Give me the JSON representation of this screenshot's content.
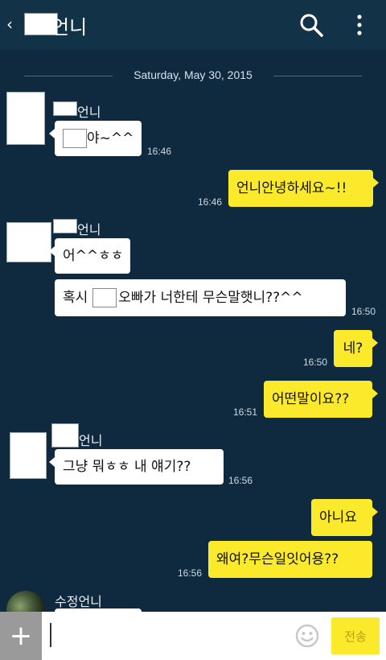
{
  "header": {
    "back_glyph": "‹",
    "title": "언니",
    "search_icon": "search-icon",
    "more_icon": "more-vertical-icon"
  },
  "date_divider": "Saturday, May 30, 2015",
  "messages": [
    {
      "sender": "언니",
      "text_suffix": "야~^^",
      "time": "16:46"
    },
    {
      "text": "언니안녕하세요~!!",
      "time": "16:46"
    },
    {
      "sender": "언니",
      "text": "어^^ㅎㅎ"
    },
    {
      "text_prefix": "혹시",
      "text_suffix": "오빠가 너한테 무슨말햇니??^^",
      "time": "16:50"
    },
    {
      "text": "네?",
      "time": "16:50"
    },
    {
      "text": "어떤말이요??",
      "time": "16:51"
    },
    {
      "sender": "언니",
      "text": "그냥 뭐ㅎㅎ 내 얘기??",
      "time": "16:56"
    },
    {
      "text": "아니요"
    },
    {
      "text": "왜여?무슨일잇어용??",
      "time": "16:56"
    },
    {
      "sender": "수정언니"
    }
  ],
  "input": {
    "plus_label": "+",
    "value": "",
    "send_label": "전송",
    "emoji_icon": "smiley-icon"
  }
}
